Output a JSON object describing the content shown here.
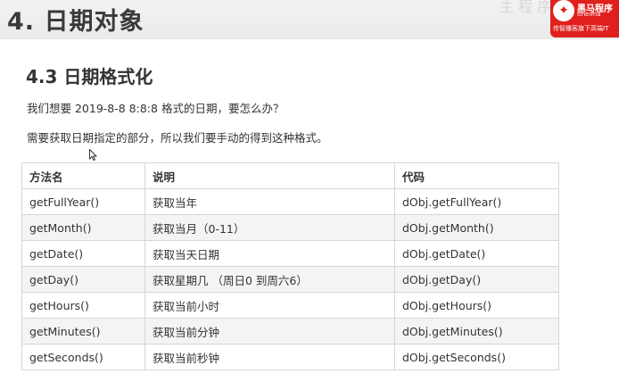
{
  "slide": {
    "title": "4. 日期对象",
    "section_title": "4.3 日期格式化",
    "question": "我们想要 2019-8-8  8:8:8 格式的日期，要怎么办？",
    "note": "需要获取日期指定的部分，所以我们要手动的得到这种格式。"
  },
  "logo": {
    "name": "黑马程序",
    "url": "itheima",
    "slogan": "传智播客旗下高端IT"
  },
  "watermark": "主 程 序",
  "table": {
    "headers": [
      "方法名",
      "说明",
      "代码"
    ],
    "rows": [
      [
        "getFullYear()",
        "获取当年",
        "dObj.getFullYear()"
      ],
      [
        "getMonth()",
        "获取当月（0-11）",
        "dObj.getMonth()"
      ],
      [
        "getDate()",
        "获取当天日期",
        "dObj.getDate()"
      ],
      [
        "getDay()",
        "获取星期几 （周日0 到周六6）",
        "dObj.getDay()"
      ],
      [
        "getHours()",
        "获取当前小时",
        "dObj.getHours()"
      ],
      [
        "getMinutes()",
        "获取当前分钟",
        "dObj.getMinutes()"
      ],
      [
        "getSeconds()",
        "获取当前秒钟",
        "dObj.getSeconds()"
      ]
    ]
  },
  "colors": {
    "logo_red": "#e0201c",
    "text": "#333333",
    "row_alt": "#f4f4f4",
    "border": "#d6d6d6"
  },
  "icons": {
    "cursor": "mouse-pointer-icon"
  }
}
